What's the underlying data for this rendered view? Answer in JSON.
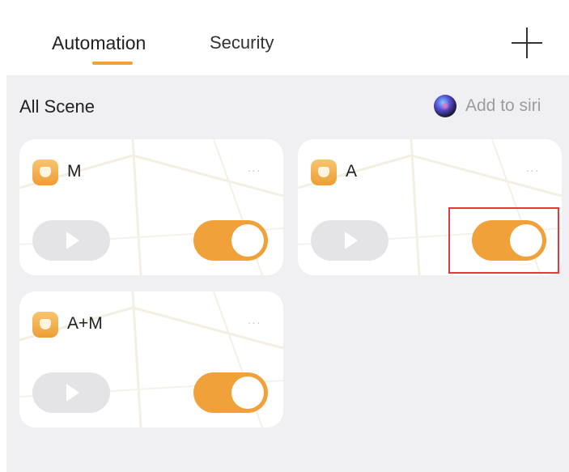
{
  "header": {
    "tabs": [
      {
        "label": "Automation",
        "active": true
      },
      {
        "label": "Security",
        "active": false
      }
    ],
    "add_icon": "plus-icon",
    "accent_color": "#f0a13a"
  },
  "section": {
    "title": "All Scene",
    "siri_label": "Add to siri",
    "siri_icon": "siri-icon"
  },
  "cards": [
    {
      "name": "M",
      "more": "···",
      "enabled": true
    },
    {
      "name": "A",
      "more": "···",
      "enabled": true
    },
    {
      "name": "A+M",
      "more": "···",
      "enabled": true
    }
  ],
  "colors": {
    "toggle_on": "#f0a13a",
    "highlight": "#e23b3b",
    "background": "#f0f0f2"
  }
}
